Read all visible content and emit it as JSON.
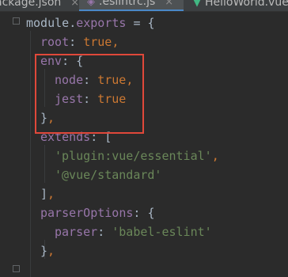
{
  "tabs": [
    {
      "label": "ackage.json",
      "icon": "json-file-icon",
      "active": false
    },
    {
      "label": ".eslintrc.js",
      "icon": "eslint-config-icon",
      "active": true
    },
    {
      "label": "HelloWorld.vue",
      "icon": "vue-file-icon",
      "active": false
    }
  ],
  "tab_close_glyph": "×",
  "code": {
    "line1": {
      "module": "module",
      "dot": ".",
      "exports": "exports",
      "rest": " = {"
    },
    "line2": {
      "key": "root",
      "colon": ": ",
      "val": "true",
      "comma": ","
    },
    "line3": {
      "key": "env",
      "colon": ": ",
      "brace": "{"
    },
    "line4": {
      "key": "node",
      "colon": ": ",
      "val": "true",
      "comma": ","
    },
    "line5": {
      "key": "jest",
      "colon": ": ",
      "val": "true"
    },
    "line6": {
      "brace": "}",
      "comma": ","
    },
    "line7": {
      "key": "extends",
      "colon": ": ",
      "bracket": "["
    },
    "line8": {
      "val": "'plugin:vue/essential'",
      "comma": ","
    },
    "line9": {
      "val": "'@vue/standard'"
    },
    "line10": {
      "bracket": "]",
      "comma": ","
    },
    "line11": {
      "key": "parserOptions",
      "colon": ": ",
      "brace": "{"
    },
    "line12": {
      "key": "parser",
      "colon": ": ",
      "val": "'babel-eslint'"
    },
    "line13": {
      "brace": "}",
      "comma": ","
    }
  },
  "colors": {
    "keyword": "#cc7832",
    "property": "#9876aa",
    "string": "#6a8759",
    "text": "#a9b7c6",
    "highlight_box": "#e0483a",
    "background": "#2b2b2b"
  }
}
